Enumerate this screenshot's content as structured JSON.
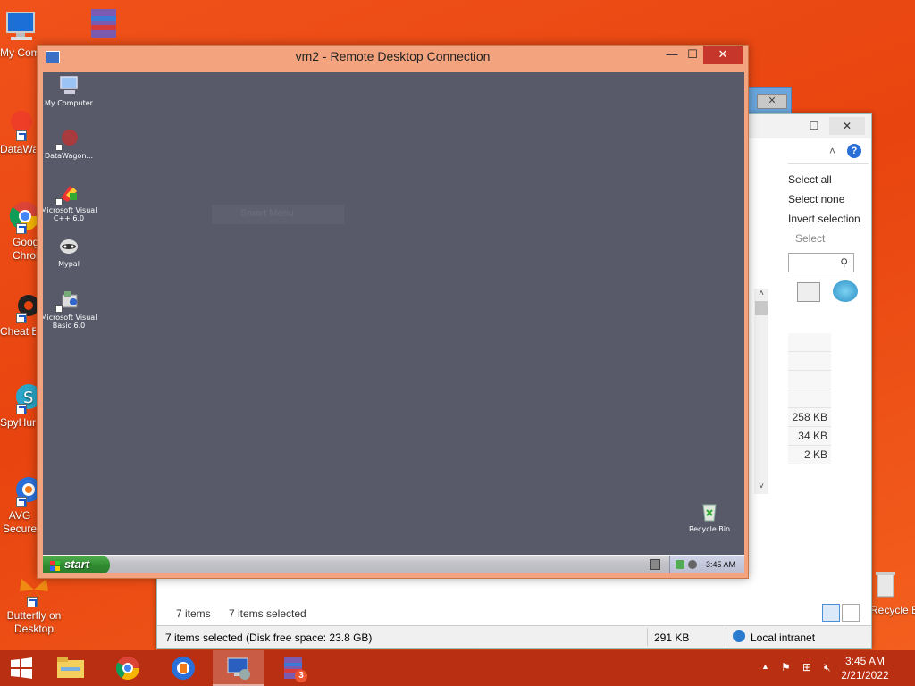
{
  "host_desktop": {
    "icons": [
      {
        "label": "My Computer",
        "name": "my-computer"
      },
      {
        "label": "DataWagon",
        "name": "datawagon"
      },
      {
        "label": "Google Chrome",
        "name": "google-chrome"
      },
      {
        "label": "Cheat Engine",
        "name": "cheat-engine"
      },
      {
        "label": "SpyHunter",
        "name": "spyhunter"
      },
      {
        "label": "AVG Secure Browser",
        "name": "avg-secure-browser"
      },
      {
        "label": "Butterfly on Desktop",
        "name": "butterfly-on-desktop"
      },
      {
        "label": "Recycle Bin",
        "name": "recycle-bin"
      }
    ]
  },
  "explorer": {
    "select_all": "Select all",
    "select_none": "Select none",
    "invert_selection": "Invert selection",
    "select_group": "Select",
    "sizes": [
      "258 KB",
      "34 KB",
      "2 KB"
    ],
    "item_count": "7 items",
    "items_selected": "7 items selected",
    "status_selection": "7 items selected (Disk free space: 23.8 GB)",
    "status_size": "291 KB",
    "status_zone": "Local intranet"
  },
  "rdc": {
    "title": "vm2 - Remote Desktop Connection",
    "minimize": "—",
    "maximize": "☐",
    "close": "✕"
  },
  "remote_desktop": {
    "icons": [
      {
        "label": "My Computer"
      },
      {
        "label": "DataWagon..."
      },
      {
        "label": "Microsoft Visual C++ 6.0"
      },
      {
        "label": "Mypal"
      },
      {
        "label": "Microsoft Visual Basic 6.0"
      },
      {
        "label": "Recycle Bin"
      }
    ],
    "ghost_text": "Smart Menu",
    "start_label": "start",
    "tray_time": "3:45 AM"
  },
  "taskbar": {
    "time": "3:45 AM",
    "date": "2/21/2022",
    "badge_count": "3"
  },
  "colors": {
    "host_bg": "#e8440f",
    "rdc_frame": "#f3a47e",
    "remote_bg": "#585a6a",
    "taskbar": "#b92f11"
  }
}
